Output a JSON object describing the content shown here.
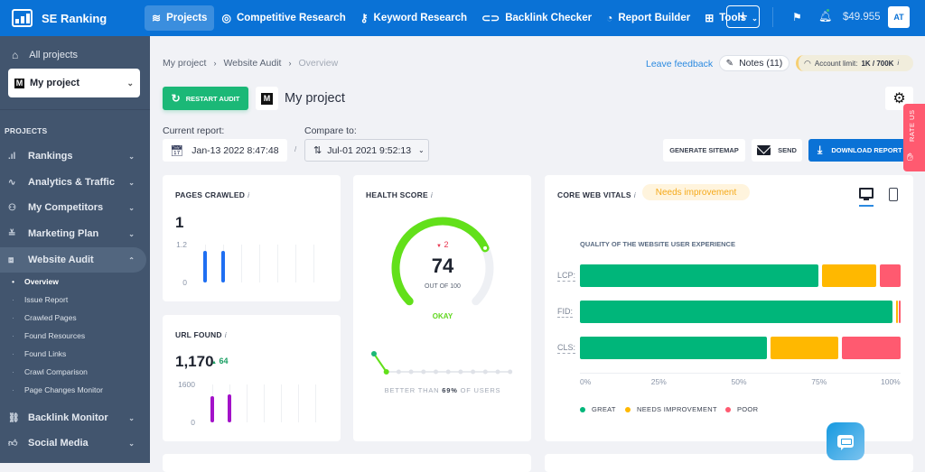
{
  "topbar": {
    "brand": "SE Ranking",
    "nav": [
      {
        "label": "Projects",
        "icon": "layers-icon",
        "active": true
      },
      {
        "label": "Competitive Research",
        "icon": "target-icon"
      },
      {
        "label": "Keyword Research",
        "icon": "key-icon"
      },
      {
        "label": "Backlink Checker",
        "icon": "link-icon"
      },
      {
        "label": "Report Builder",
        "icon": "pie-chart-icon"
      },
      {
        "label": "Tools",
        "icon": "grid-icon",
        "has_dropdown": true
      }
    ],
    "add_label": "+",
    "balance": "$49.955",
    "avatar_initials": "AT"
  },
  "sidebar": {
    "all_projects": "All projects",
    "project_selector": "My project",
    "section_label": "PROJECTS",
    "items": [
      {
        "label": "Rankings",
        "icon": "bar-chart-icon"
      },
      {
        "label": "Analytics & Traffic",
        "icon": "pulse-icon"
      },
      {
        "label": "My Competitors",
        "icon": "people-icon"
      },
      {
        "label": "Marketing Plan",
        "icon": "checklist-icon"
      },
      {
        "label": "Website Audit",
        "icon": "audit-icon",
        "expanded": true
      },
      {
        "label": "Backlink Monitor",
        "icon": "link-icon"
      },
      {
        "label": "Social Media",
        "icon": "thumbs-up-icon"
      }
    ],
    "audit_subitems": [
      {
        "label": "Overview",
        "active": true
      },
      {
        "label": "Issue Report"
      },
      {
        "label": "Crawled Pages"
      },
      {
        "label": "Found Resources"
      },
      {
        "label": "Found Links"
      },
      {
        "label": "Crawl Comparison"
      },
      {
        "label": "Page Changes Monitor"
      }
    ]
  },
  "header": {
    "breadcrumb": [
      "My project",
      "Website Audit",
      "Overview"
    ],
    "restart_audit": "RESTART AUDIT",
    "project_title": "My project",
    "leave_feedback": "Leave feedback",
    "notes": "Notes (11)",
    "account_limit_label": "Account limit:",
    "account_limit_value": "1K / 700K",
    "current_report_label": "Current report:",
    "current_report_value": "Jan-13 2022 8:47:48",
    "compare_to_label": "Compare to:",
    "compare_to_value": "Jul-01 2021 9:52:13",
    "generate_sitemap": "GENERATE SITEMAP",
    "send": "SEND",
    "download_report": "DOWNLOAD REPORT",
    "rate_us": "RATE US"
  },
  "pages_crawled": {
    "title": "PAGES CRAWLED",
    "info": "i",
    "value": "1",
    "y_max_label": "1.2",
    "y_min_label": "0",
    "y_max": 1.2,
    "bars": [
      1,
      1
    ],
    "bar_color": "#1f6ff2"
  },
  "url_found": {
    "title": "URL FOUND",
    "info": "i",
    "value": "1,170",
    "delta": "64",
    "y_max_label": "1600",
    "y_min_label": "0",
    "y_max": 1600,
    "bars": [
      1106,
      1170
    ],
    "bar_color": "#a312c9"
  },
  "health_score": {
    "title": "HEALTH SCORE",
    "info": "i",
    "delta": "2",
    "value": "74",
    "score": 74,
    "out_of": "OUT OF 100",
    "status": "OKAY",
    "better_than_prefix": "BETTER THAN",
    "better_than_value": "69%",
    "better_than_suffix": "OF USERS",
    "history": [
      76,
      74
    ]
  },
  "core_web_vitals": {
    "title": "CORE WEB VITALS",
    "info": "i",
    "status_badge": "Needs improvement",
    "subtitle": "QUALITY OF THE WEBSITE USER EXPERIENCE",
    "device_selected": "desktop",
    "colors": {
      "great": "#00b67a",
      "needs": "#ffb800",
      "poor": "#ff5a70"
    }
  },
  "chart_data": {
    "type": "bar",
    "stacked": true,
    "orientation": "horizontal",
    "title": "QUALITY OF THE WEBSITE USER EXPERIENCE",
    "categories": [
      "LCP:",
      "FID:",
      "CLS:"
    ],
    "series": [
      {
        "name": "GREAT",
        "values": [
          75,
          98,
          59
        ]
      },
      {
        "name": "NEEDS IMPROVEMENT",
        "values": [
          18,
          1,
          22
        ]
      },
      {
        "name": "POOR",
        "values": [
          7,
          1,
          19
        ]
      }
    ],
    "x_ticks": [
      "0%",
      "25%",
      "50%",
      "75%",
      "100%"
    ],
    "xlim": [
      0,
      100
    ],
    "legend": "bottom-left"
  }
}
